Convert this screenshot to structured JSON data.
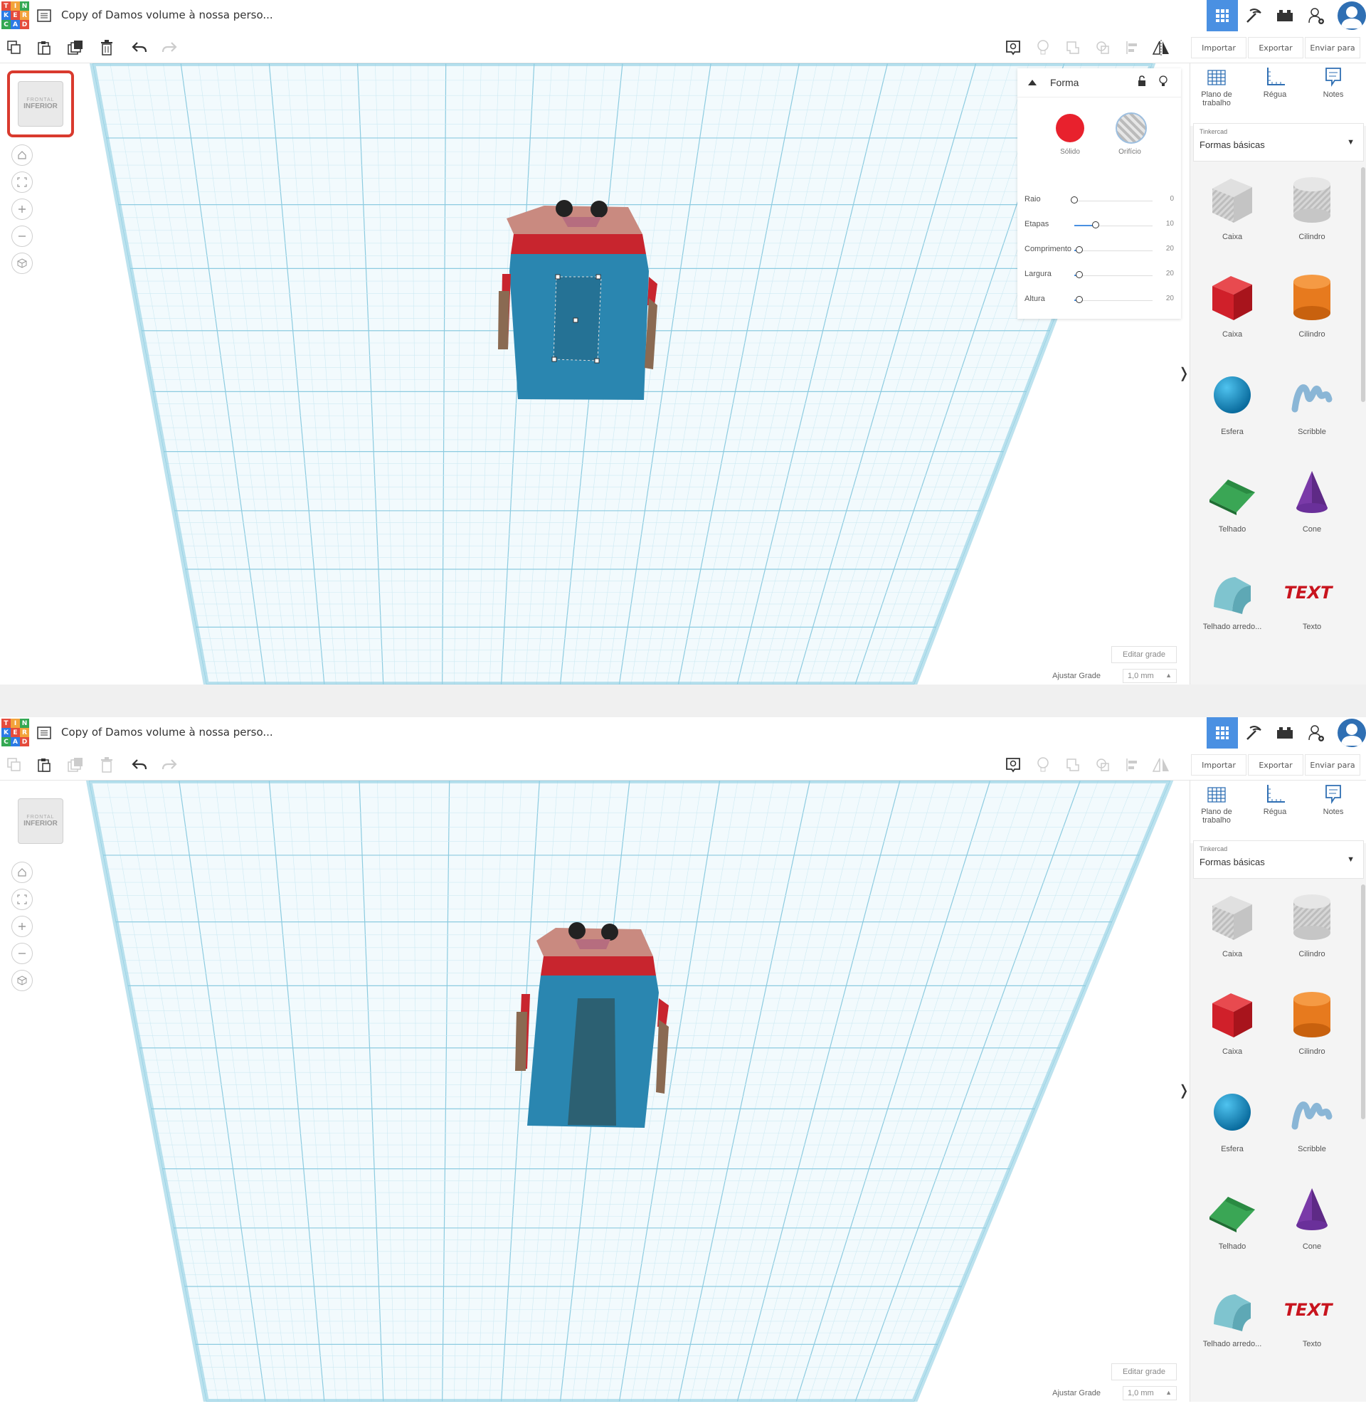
{
  "app": {
    "project_title": "Copy of Damos volume à nossa perso...",
    "logo_letters": [
      "T",
      "I",
      "N",
      "K",
      "E",
      "R",
      "C",
      "A",
      "D"
    ],
    "logo_colors": [
      "#e54b3c",
      "#f3a33b",
      "#34a853",
      "#2c7be5",
      "#e54b3c",
      "#f3a33b",
      "#34a853",
      "#2c7be5",
      "#e54b3c"
    ]
  },
  "toolbar": {
    "import_label": "Importar",
    "export_label": "Exportar",
    "send_label": "Enviar para"
  },
  "sidebar": {
    "tabs": [
      {
        "label": "Plano de trabalho",
        "icon": "workplane-icon"
      },
      {
        "label": "Régua",
        "icon": "ruler-icon"
      },
      {
        "label": "Notes",
        "icon": "notes-icon"
      }
    ],
    "library_source": "Tinkercad",
    "library_name": "Formas básicas",
    "shapes": [
      {
        "label": "Caixa",
        "icon": "box-hole-icon"
      },
      {
        "label": "Cilindro",
        "icon": "cylinder-hole-icon"
      },
      {
        "label": "Caixa",
        "icon": "box-icon"
      },
      {
        "label": "Cilindro",
        "icon": "cylinder-icon"
      },
      {
        "label": "Esfera",
        "icon": "sphere-icon"
      },
      {
        "label": "Scribble",
        "icon": "scribble-icon"
      },
      {
        "label": "Telhado",
        "icon": "roof-icon"
      },
      {
        "label": "Cone",
        "icon": "cone-icon"
      },
      {
        "label": "Telhado arredo...",
        "icon": "round-roof-icon"
      },
      {
        "label": "Texto",
        "icon": "text-icon"
      }
    ]
  },
  "viewcube": {
    "top_label": "FRONTAL",
    "face_label": "INFERIOR"
  },
  "canvas": {
    "edit_grid_label": "Editar grade",
    "snap_label": "Ajustar Grade",
    "snap_value": "1,0 mm"
  },
  "inspector": {
    "title": "Forma",
    "solid_label": "Sólido",
    "hole_label": "Orifício",
    "params": [
      {
        "label": "Raio",
        "value": "0",
        "level": 0.0
      },
      {
        "label": "Etapas",
        "value": "10",
        "level": 0.27
      },
      {
        "label": "Comprimento",
        "value": "20",
        "level": 0.06
      },
      {
        "label": "Largura",
        "value": "20",
        "level": 0.06
      },
      {
        "label": "Altura",
        "value": "20",
        "level": 0.06
      }
    ]
  },
  "colors": {
    "accent": "#4a90e2",
    "highlight_border": "#d93a2e",
    "grid_line": "#9fd3e3",
    "model_blue": "#2a86b0",
    "model_red": "#c8252e",
    "model_brown": "#8a6a52"
  }
}
